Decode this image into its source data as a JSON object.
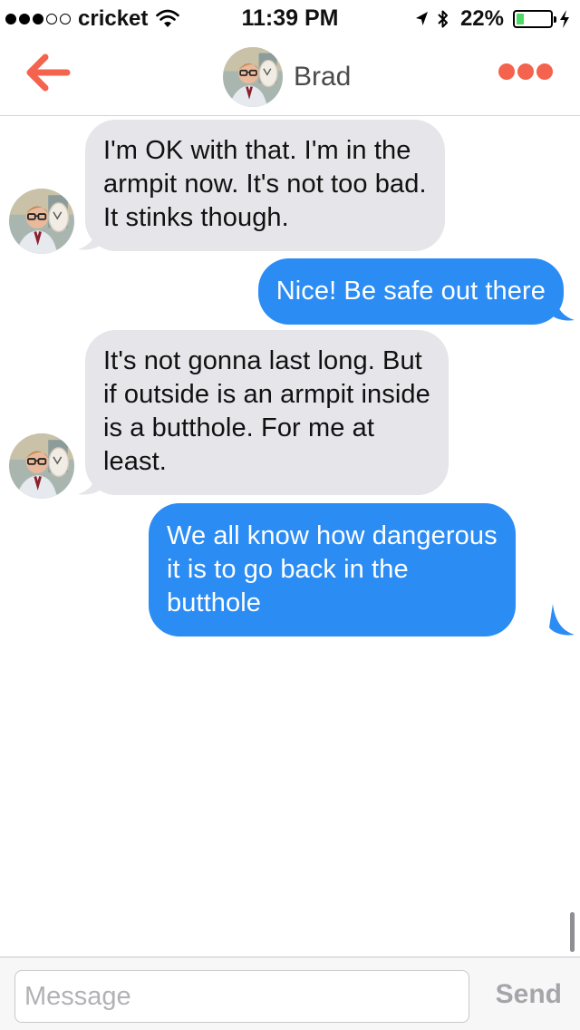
{
  "status_bar": {
    "signal_strength": 3,
    "signal_max": 5,
    "carrier": "cricket",
    "time": "11:39 PM",
    "battery_pct": "22%",
    "battery_level": 0.22,
    "battery_color": "#4cd964"
  },
  "header": {
    "back_icon": "arrow-left-icon",
    "contact_name": "Brad",
    "more_icon": "more-dots-icon",
    "accent": "#f4634d"
  },
  "messages": [
    {
      "from": "them",
      "lines": [
        "I'm OK with that. I'm in the",
        "armpit now. It's not too bad.",
        "It stinks though."
      ]
    },
    {
      "from": "me",
      "lines": [
        "Nice! Be safe out there"
      ]
    },
    {
      "from": "them",
      "lines": [
        "It's not gonna last long. But",
        "if outside is an armpit inside",
        "is a butthole. For me at",
        "least."
      ]
    },
    {
      "from": "me",
      "lines": [
        "We all know how dangerous",
        "it is to go back in the",
        "butthole"
      ]
    }
  ],
  "composer": {
    "placeholder": "Message",
    "value": "",
    "send_label": "Send"
  },
  "colors": {
    "incoming_bubble": "#e5e5ea",
    "outgoing_bubble": "#2b8cf4"
  }
}
